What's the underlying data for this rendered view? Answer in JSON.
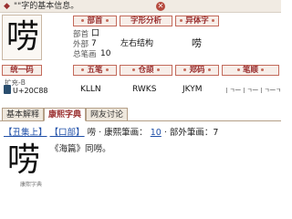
{
  "header": {
    "bullet": "◆",
    "title": "\"\"字的基本信息。",
    "close_icon": "✕"
  },
  "char": "唠",
  "fields": {
    "radical_header": "部首",
    "structure_header": "字形分析",
    "pinyin_header": "异体字",
    "radical_label": "部首",
    "radical_value": "口",
    "strokes_outside_label": "外部",
    "strokes_outside_value": "7",
    "strokes_total_label": "总笔画",
    "strokes_total_value": "10",
    "structure_value": "左右结构",
    "variant_value": "唠"
  },
  "codes": {
    "unicode_header": "统一码",
    "wubi_header": "五笔",
    "cangjie_header": "仓颉",
    "zhengma_header": "郑码",
    "stroke_header": "笔顺",
    "unicode_label": "扩充-B",
    "unicode_value": "U+20C88",
    "wubi_value": "KLLN",
    "cangjie_value": "RWKS",
    "zhengma_value": "JKYM",
    "stroke_value": "丨ㄱ一丨ㄱ一丨ㄱ一ㄱ"
  },
  "tabs": [
    {
      "label": "基本解释"
    },
    {
      "label": "康熙字典"
    },
    {
      "label": "网友讨论"
    }
  ],
  "kangxi": {
    "ref_chou": "【丑集上】",
    "ref_kou": "【口部】",
    "char": "唠",
    "part_label": "· 康熙筆画：",
    "stroke_link": "10",
    "outside_label": "· 部外筆画：7",
    "big_char": "唠",
    "caption": "康熙字典",
    "quote": "《海篇》同嘮。"
  }
}
